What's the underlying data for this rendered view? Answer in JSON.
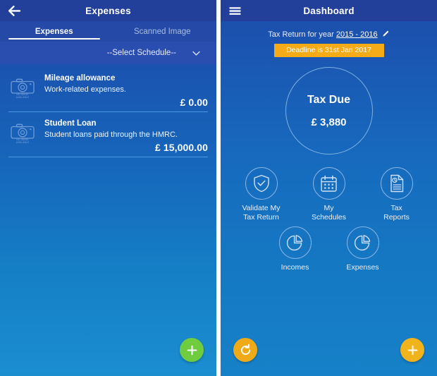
{
  "expenses_screen": {
    "appbar": {
      "title": "Expenses",
      "back_icon": "back-arrow-icon"
    },
    "tabs": [
      {
        "label": "Expenses",
        "active": true
      },
      {
        "label": "Scanned Image",
        "active": false
      }
    ],
    "schedule_select": {
      "value": "--Select Schedule--",
      "icon": "chevron-down-icon"
    },
    "items": [
      {
        "title": "Mileage allowance",
        "subtitle": "Work-related expenses.",
        "amount": "£ 0.00",
        "thumb_icon": "camera-icon",
        "thumb_text_line1": "NO IMAGE",
        "thumb_text_line2": "AVAILABLE"
      },
      {
        "title": "Student Loan",
        "subtitle": "Student loans paid through the HMRC.",
        "amount": "£ 15,000.00",
        "thumb_icon": "camera-icon",
        "thumb_text_line1": "NO IMAGE",
        "thumb_text_line2": "AVAILABLE"
      }
    ],
    "fab": {
      "icon": "plus-icon",
      "color": "#70cc3f"
    }
  },
  "dashboard_screen": {
    "appbar": {
      "title": "Dashboard",
      "menu_icon": "hamburger-menu-icon"
    },
    "tax_return": {
      "prefix": "Tax Return for year",
      "year": "2015 - 2016",
      "edit_icon": "pencil-icon"
    },
    "deadline_badge": {
      "text": "Deadline is 31st Jan 2017",
      "color": "#f5ab18"
    },
    "tax_due": {
      "label": "Tax Due",
      "value": "£ 3,880"
    },
    "menu_row1": [
      {
        "label_line1": "Validate My",
        "label_line2": "Tax Return",
        "icon": "shield-check-icon"
      },
      {
        "label_line1": "My",
        "label_line2": "Schedules",
        "icon": "calendar-icon"
      },
      {
        "label_line1": "Tax",
        "label_line2": "Reports",
        "icon": "document-clock-icon"
      }
    ],
    "menu_row2": [
      {
        "label_line1": "Incomes",
        "label_line2": "",
        "icon": "pie-chart-icon"
      },
      {
        "label_line1": "Expenses",
        "label_line2": "",
        "icon": "pie-chart-icon"
      }
    ],
    "fab_refresh": {
      "icon": "refresh-icon",
      "color": "#eeab17"
    },
    "fab_add": {
      "icon": "plus-icon",
      "color": "#f0b31b"
    }
  }
}
